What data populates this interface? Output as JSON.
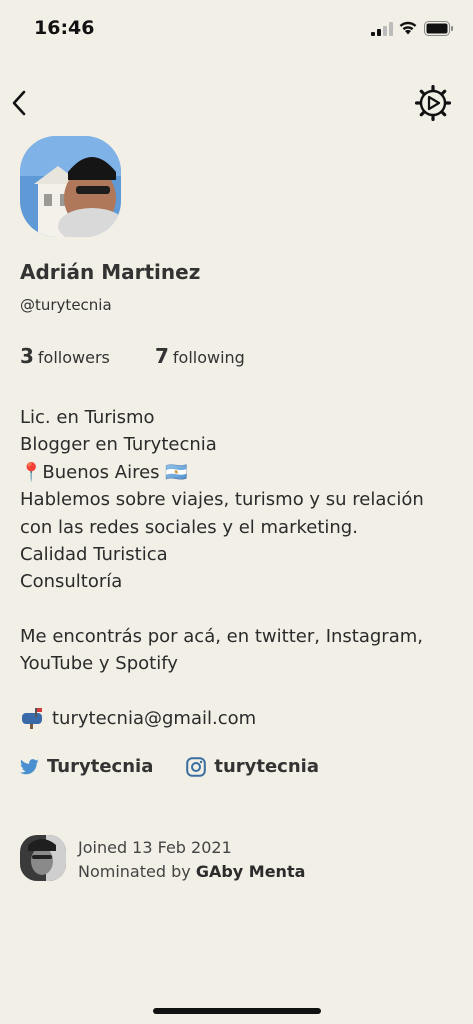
{
  "status_bar": {
    "time": "16:46"
  },
  "profile": {
    "name": "Adrián Martinez",
    "handle": "@turytecnia",
    "followers_count": "3",
    "followers_label": "followers",
    "following_count": "7",
    "following_label": "following"
  },
  "bio": {
    "lines": [
      "Lic. en Turismo",
      "Blogger en Turytecnia",
      "📍Buenos Aires 🇦🇷",
      "Hablemos sobre viajes, turismo y su relación",
      "con las redes sociales y el marketing.",
      "Calidad Turistica",
      "Consultoría",
      "",
      "Me encontrás por acá, en twitter, Instagram,",
      "YouTube y Spotify"
    ],
    "email": "turytecnia@gmail.com"
  },
  "socials": {
    "twitter": "Turytecnia",
    "instagram": "turytecnia"
  },
  "joined": {
    "joined_text": "Joined 13 Feb 2021",
    "nominated_prefix": "Nominated by",
    "nominated_by": "GAby Menta"
  },
  "colors": {
    "background": "#f2efe6",
    "text": "#333333",
    "twitter": "#4a8fcf",
    "instagram": "#3a6e9e"
  },
  "icons": [
    "signal-icon",
    "wifi-icon",
    "battery-icon",
    "back-arrow-icon",
    "settings-gear-icon",
    "mailbox-icon",
    "twitter-icon",
    "instagram-icon"
  ]
}
